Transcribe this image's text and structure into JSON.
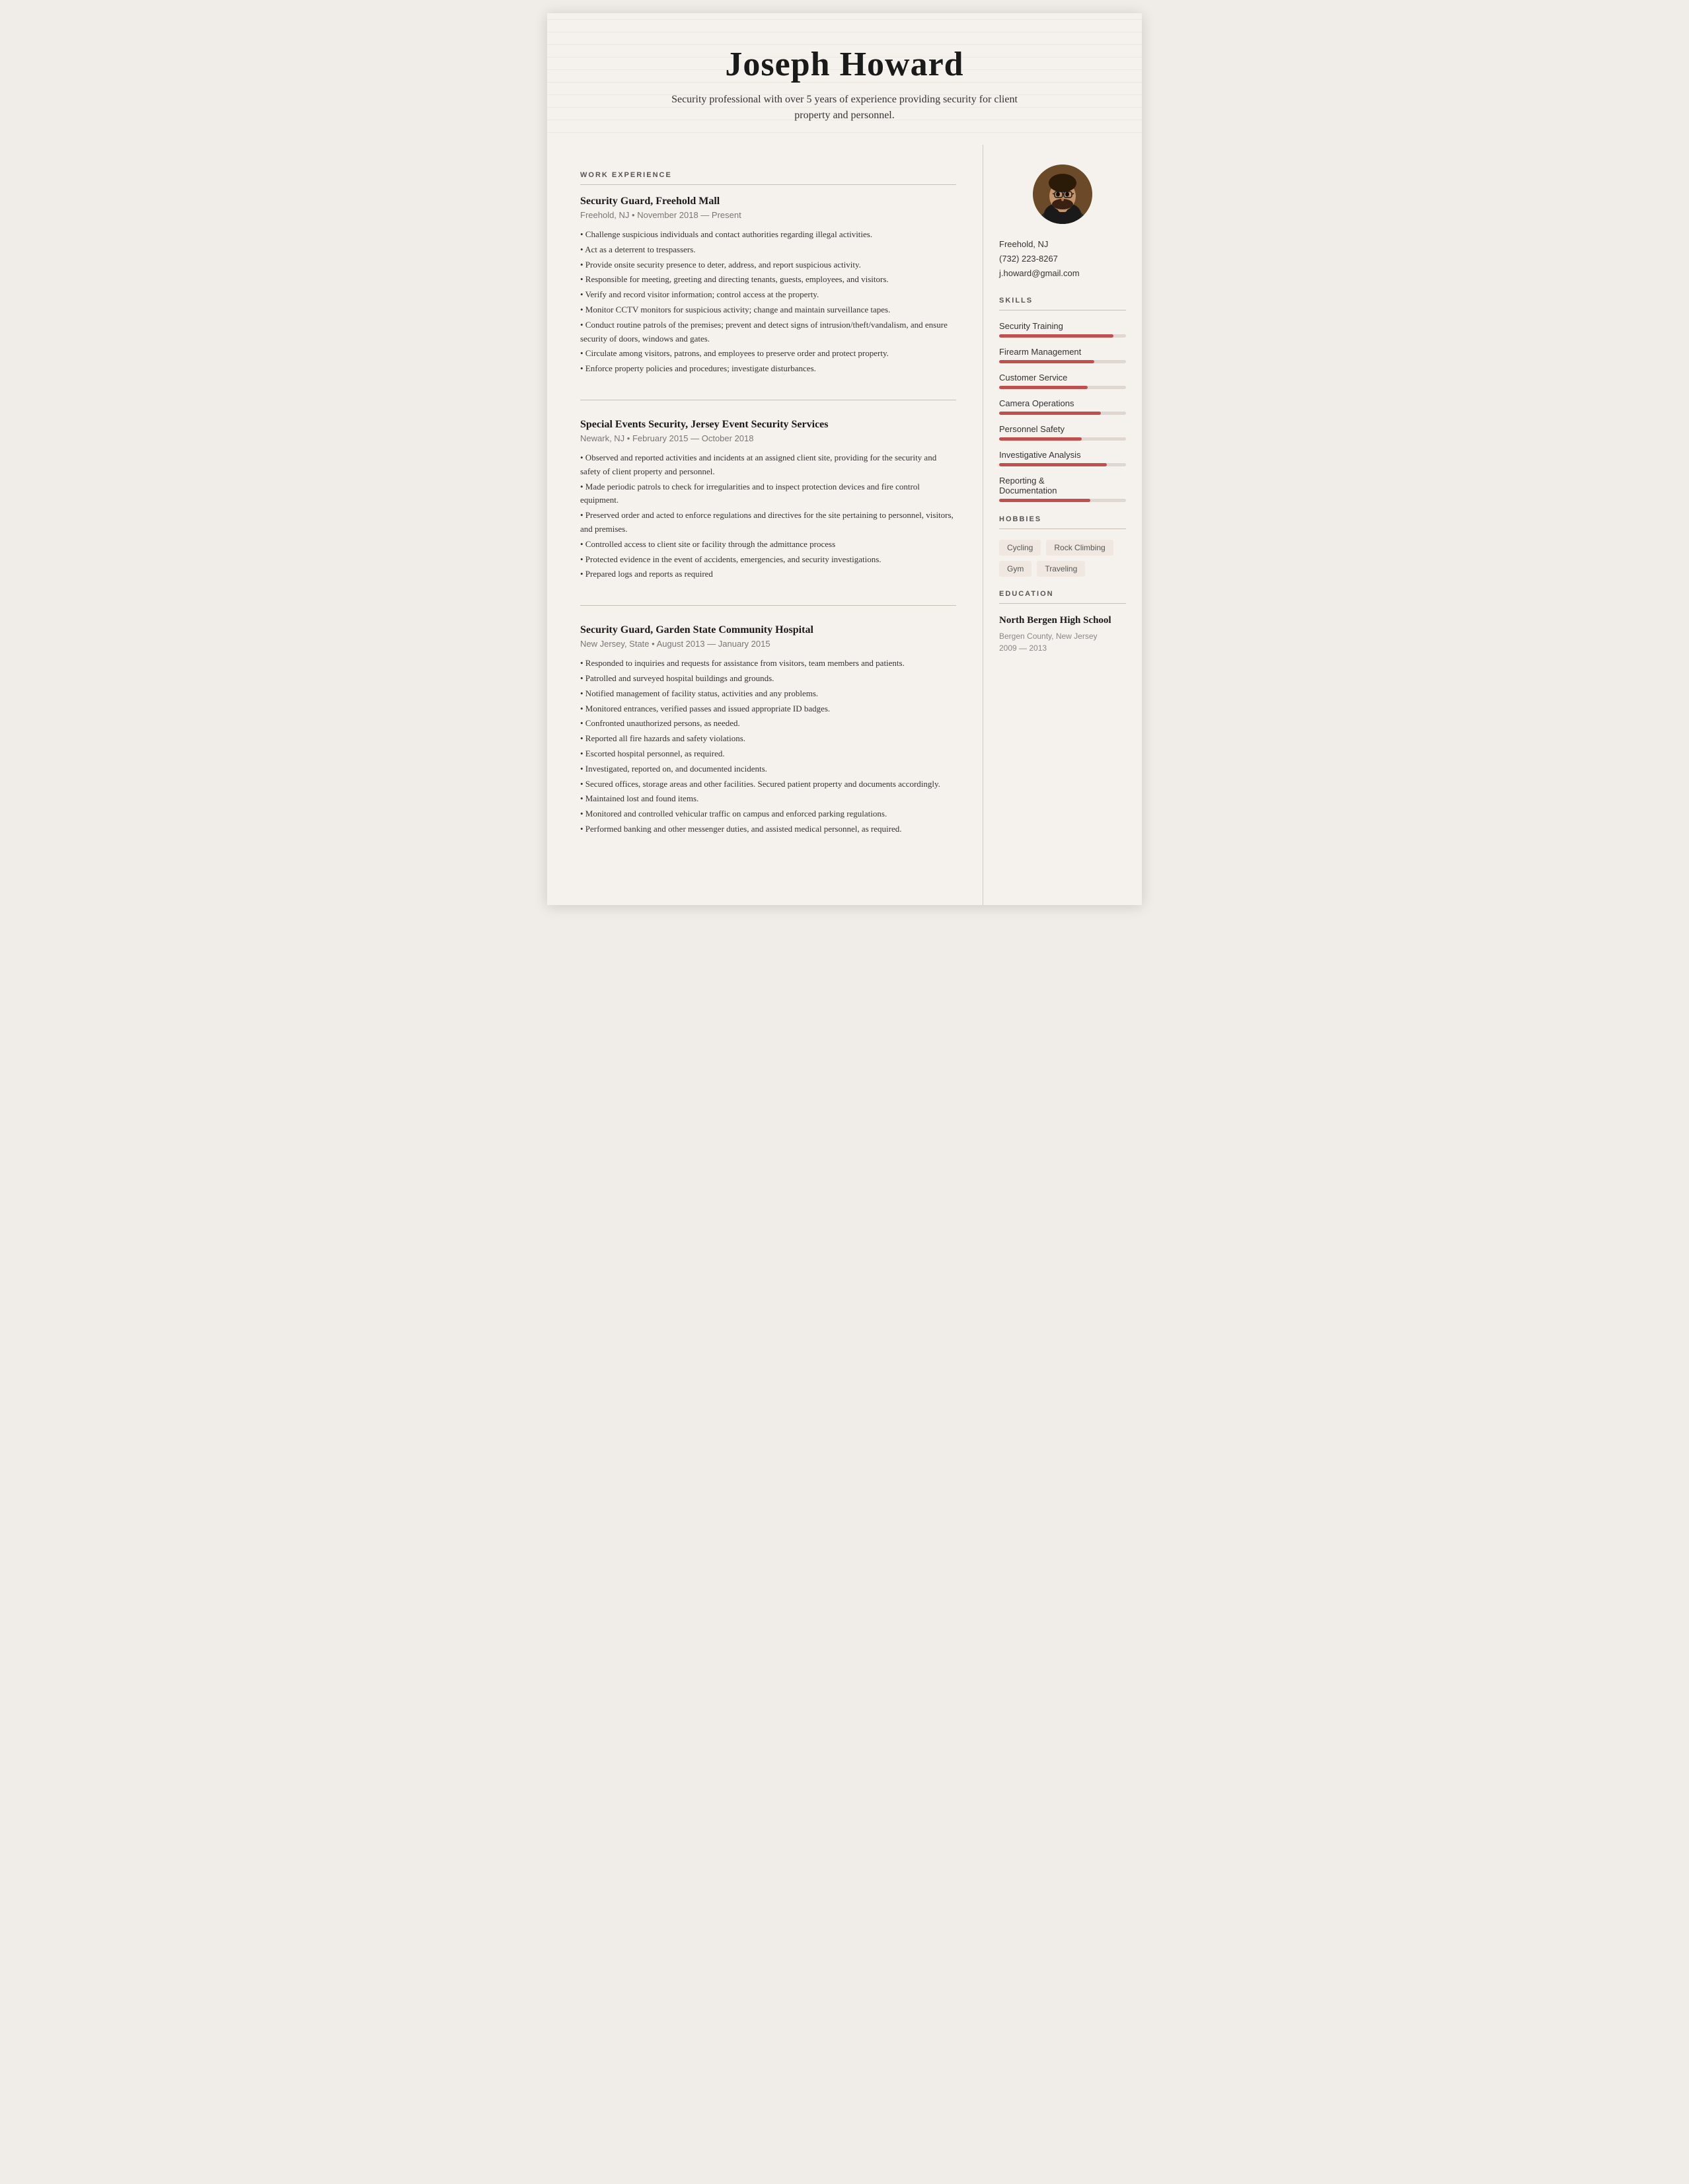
{
  "header": {
    "name": "Joseph Howard",
    "tagline": "Security professional with over 5 years of experience providing security for client\nproperty and personnel."
  },
  "sections": {
    "work_experience_label": "WORK EXPERIENCE",
    "skills_label": "SKILLS",
    "hobbies_label": "HOBBIES",
    "education_label": "EDUCATION"
  },
  "jobs": [
    {
      "title": "Security Guard, Freehold Mall",
      "meta": "Freehold, NJ • November 2018 — Present",
      "bullets": [
        "• Challenge suspicious individuals and contact authorities regarding illegal activities.",
        "• Act as a deterrent to trespassers.",
        "• Provide onsite security presence to deter, address, and report suspicious activity.",
        "• Responsible for meeting, greeting and directing tenants, guests, employees, and visitors.",
        "• Verify and record visitor information; control access at the property.",
        "• Monitor CCTV monitors for suspicious activity; change and maintain surveillance tapes.",
        "• Conduct routine patrols of the premises; prevent and detect signs of intrusion/theft/vandalism, and ensure security of doors, windows and gates.",
        "• Circulate among visitors, patrons, and employees to preserve order and protect property.",
        "• Enforce property policies and procedures; investigate disturbances."
      ]
    },
    {
      "title": "Special Events Security, Jersey Event Security Services",
      "meta": "Newark, NJ • February 2015 — October 2018",
      "bullets": [
        "• Observed and reported activities and incidents at an assigned client site, providing for the security and safety of client property and personnel.",
        "• Made periodic patrols to check for irregularities and to inspect protection devices and fire control equipment.",
        "• Preserved order and acted to enforce regulations and directives for the site pertaining to personnel, visitors, and premises.",
        "• Controlled access to client site or facility through the admittance process",
        "• Protected evidence in the event of accidents, emergencies, and security investigations.",
        "• Prepared logs and reports as required"
      ]
    },
    {
      "title": "Security Guard, Garden State Community Hospital",
      "meta": "New Jersey, State • August 2013 — January 2015",
      "bullets": [
        "• Responded to inquiries and requests for assistance from visitors, team members and patients.",
        "• Patrolled and surveyed hospital buildings and grounds.",
        "• Notified management of facility status, activities and any problems.",
        "• Monitored entrances, verified passes and issued appropriate ID badges.",
        "• Confronted unauthorized persons, as needed.",
        "• Reported all fire hazards and safety violations.",
        "• Escorted hospital personnel, as required.",
        "• Investigated, reported on, and documented incidents.",
        "• Secured offices, storage areas and other facilities. Secured patient property and documents accordingly.",
        "• Maintained lost and found items.",
        "• Monitored and controlled vehicular traffic on campus and enforced parking regulations.",
        "• Performed banking and other messenger duties, and assisted medical personnel, as required."
      ]
    }
  ],
  "contact": {
    "location": "Freehold, NJ",
    "phone": "(732) 223-8267",
    "email": "j.howard@gmail.com"
  },
  "skills": [
    {
      "name": "Security Training",
      "percent": 90
    },
    {
      "name": "Firearm Management",
      "percent": 75
    },
    {
      "name": "Customer Service",
      "percent": 70
    },
    {
      "name": "Camera Operations",
      "percent": 80
    },
    {
      "name": "Personnel Safety",
      "percent": 65
    },
    {
      "name": "Investigative Analysis",
      "percent": 85
    },
    {
      "name": "Reporting &\nDocumentation",
      "percent": 72
    }
  ],
  "hobbies": [
    "Cycling",
    "Rock Climbing",
    "Gym",
    "Traveling"
  ],
  "education": {
    "school": "North Bergen High School",
    "location": "Bergen County, New Jersey",
    "years": "2009 — 2013"
  }
}
